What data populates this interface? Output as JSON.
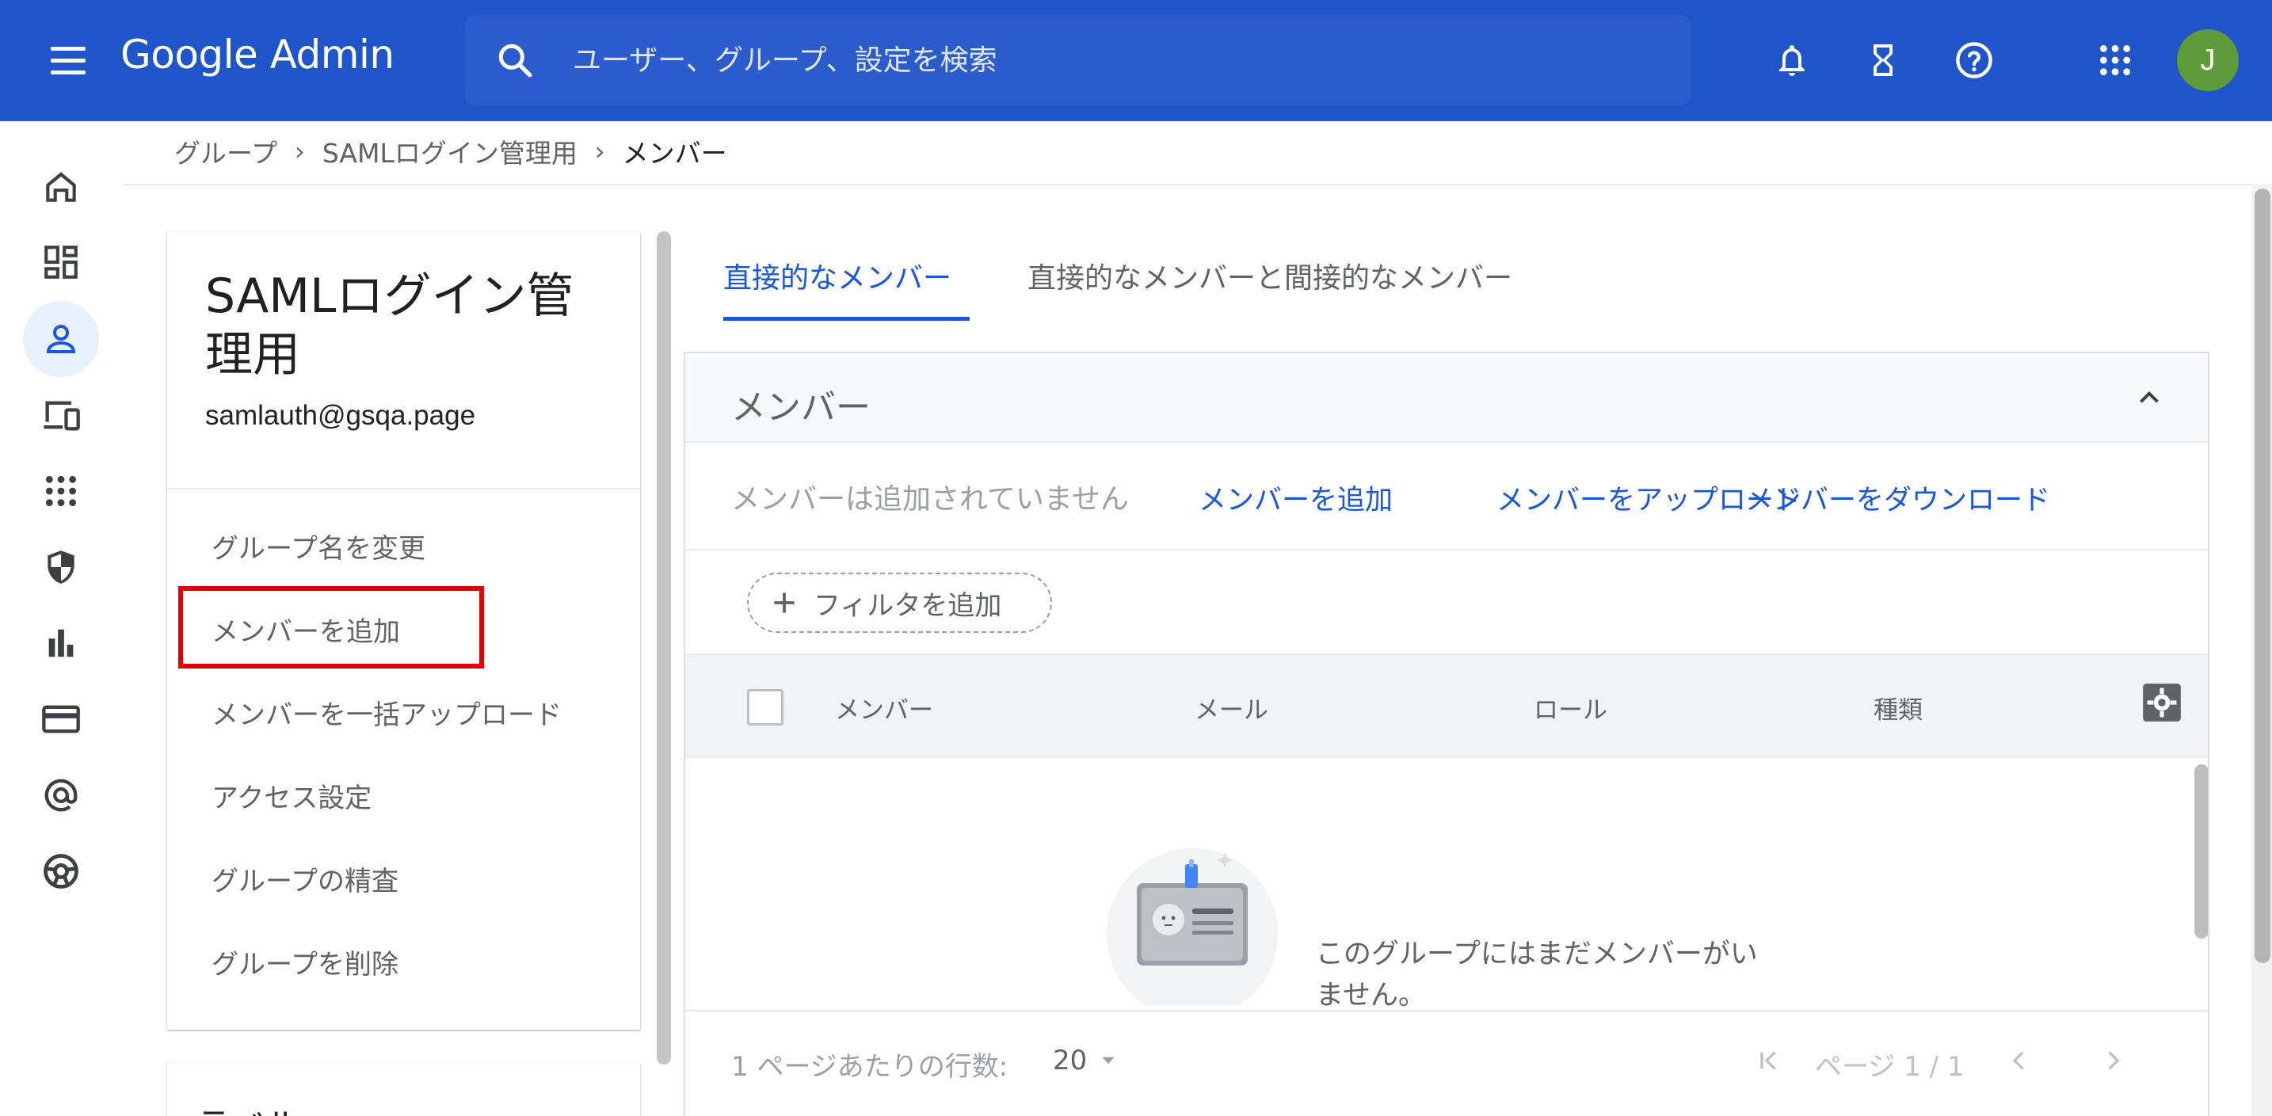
{
  "app": {
    "brand": "Google Admin",
    "search_placeholder": "ユーザー、グループ、設定を検索",
    "avatar_initial": "J",
    "accent_color": "#1f55c9",
    "link_color": "#1a57d6"
  },
  "top_icons": [
    "notifications-icon",
    "tasks-hourglass-icon",
    "help-icon",
    "apps-grid-icon"
  ],
  "rail": {
    "items": [
      {
        "name": "home-icon",
        "active": false
      },
      {
        "name": "dashboard-icon",
        "active": false
      },
      {
        "name": "users-icon",
        "active": true
      },
      {
        "name": "devices-icon",
        "active": false
      },
      {
        "name": "apps-icon",
        "active": false
      },
      {
        "name": "security-shield-icon",
        "active": false
      },
      {
        "name": "reports-bar-chart-icon",
        "active": false
      },
      {
        "name": "billing-card-icon",
        "active": false
      },
      {
        "name": "domains-at-icon",
        "active": false
      },
      {
        "name": "support-lifebuoy-icon",
        "active": false
      }
    ]
  },
  "breadcrumb": {
    "items": [
      "グループ",
      "SAMLログイン管理用",
      "メンバー"
    ]
  },
  "group": {
    "title": "SAMLログイン管理用",
    "email": "samlauth@gsqa.page",
    "actions": [
      "グループ名を変更",
      "メンバーを追加",
      "メンバーを一括アップロード",
      "アクセス設定",
      "グループの精査",
      "グループを削除"
    ],
    "label_card_title": "ラベル"
  },
  "tabs": {
    "direct": "直接的なメンバー",
    "all": "直接的なメンバーと間接的なメンバー"
  },
  "members_panel": {
    "title": "メンバー",
    "empty_note": "メンバーは追加されていません",
    "links": [
      "メンバーを追加",
      "メンバーをアップロード",
      "メンバーをダウンロード"
    ],
    "filter_label": "フィルタを追加",
    "columns": [
      "メンバー",
      "メール",
      "ロール",
      "種類"
    ],
    "empty_message": "このグループにはまだメンバーがいません。",
    "rows_per_page_label": "1 ページあたりの行数:",
    "rows_per_page_value": "20",
    "page_label": "ページ 1 / 1"
  }
}
